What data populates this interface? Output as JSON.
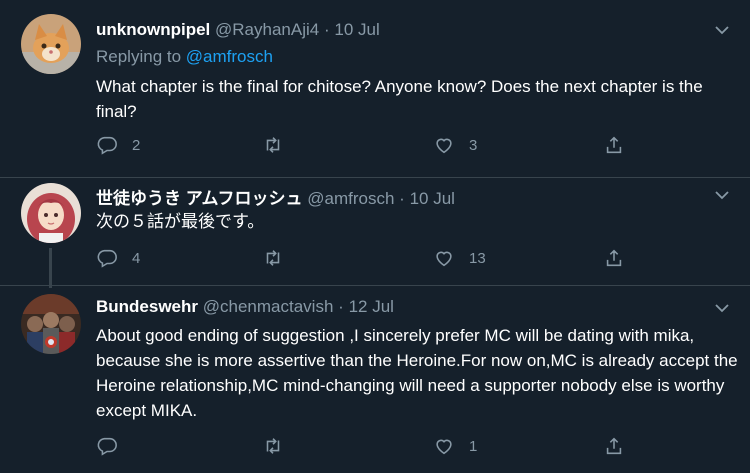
{
  "colors": {
    "background": "#15202b",
    "text": "#ffffff",
    "muted": "#8899a6",
    "link": "#1da1f2",
    "divider": "#38444d"
  },
  "tweets": [
    {
      "display_name": "unknownpipel",
      "handle": "@RayhanAji4",
      "separator": "·",
      "date": "10 Jul",
      "replying_label": "Replying to",
      "replying_handle": "@amfrosch",
      "text": "What chapter is the final for chitose? Anyone know? Does the next chapter is the final?",
      "reply_count": "2",
      "retweet_count": "",
      "like_count": "3"
    },
    {
      "display_name": "世徒ゆうき アムフロッシュ",
      "handle": "@amfrosch",
      "separator": "·",
      "date": "10 Jul",
      "text": "次の５話が最後です。",
      "reply_count": "4",
      "retweet_count": "",
      "like_count": "13"
    },
    {
      "display_name": "Bundeswehr",
      "handle": "@chenmactavish",
      "separator": "·",
      "date": "12 Jul",
      "text": "About good ending of suggestion ,I sincerely prefer MC will be dating with mika, because she is more assertive than the Heroine.For now on,MC is already accept the Heroine relationship,MC mind-changing will need a supporter nobody else is worthy except MIKA.",
      "reply_count": "",
      "retweet_count": "",
      "like_count": "1"
    }
  ],
  "icons": [
    "reply-icon",
    "retweet-icon",
    "like-icon",
    "share-icon",
    "chevron-down-icon"
  ]
}
